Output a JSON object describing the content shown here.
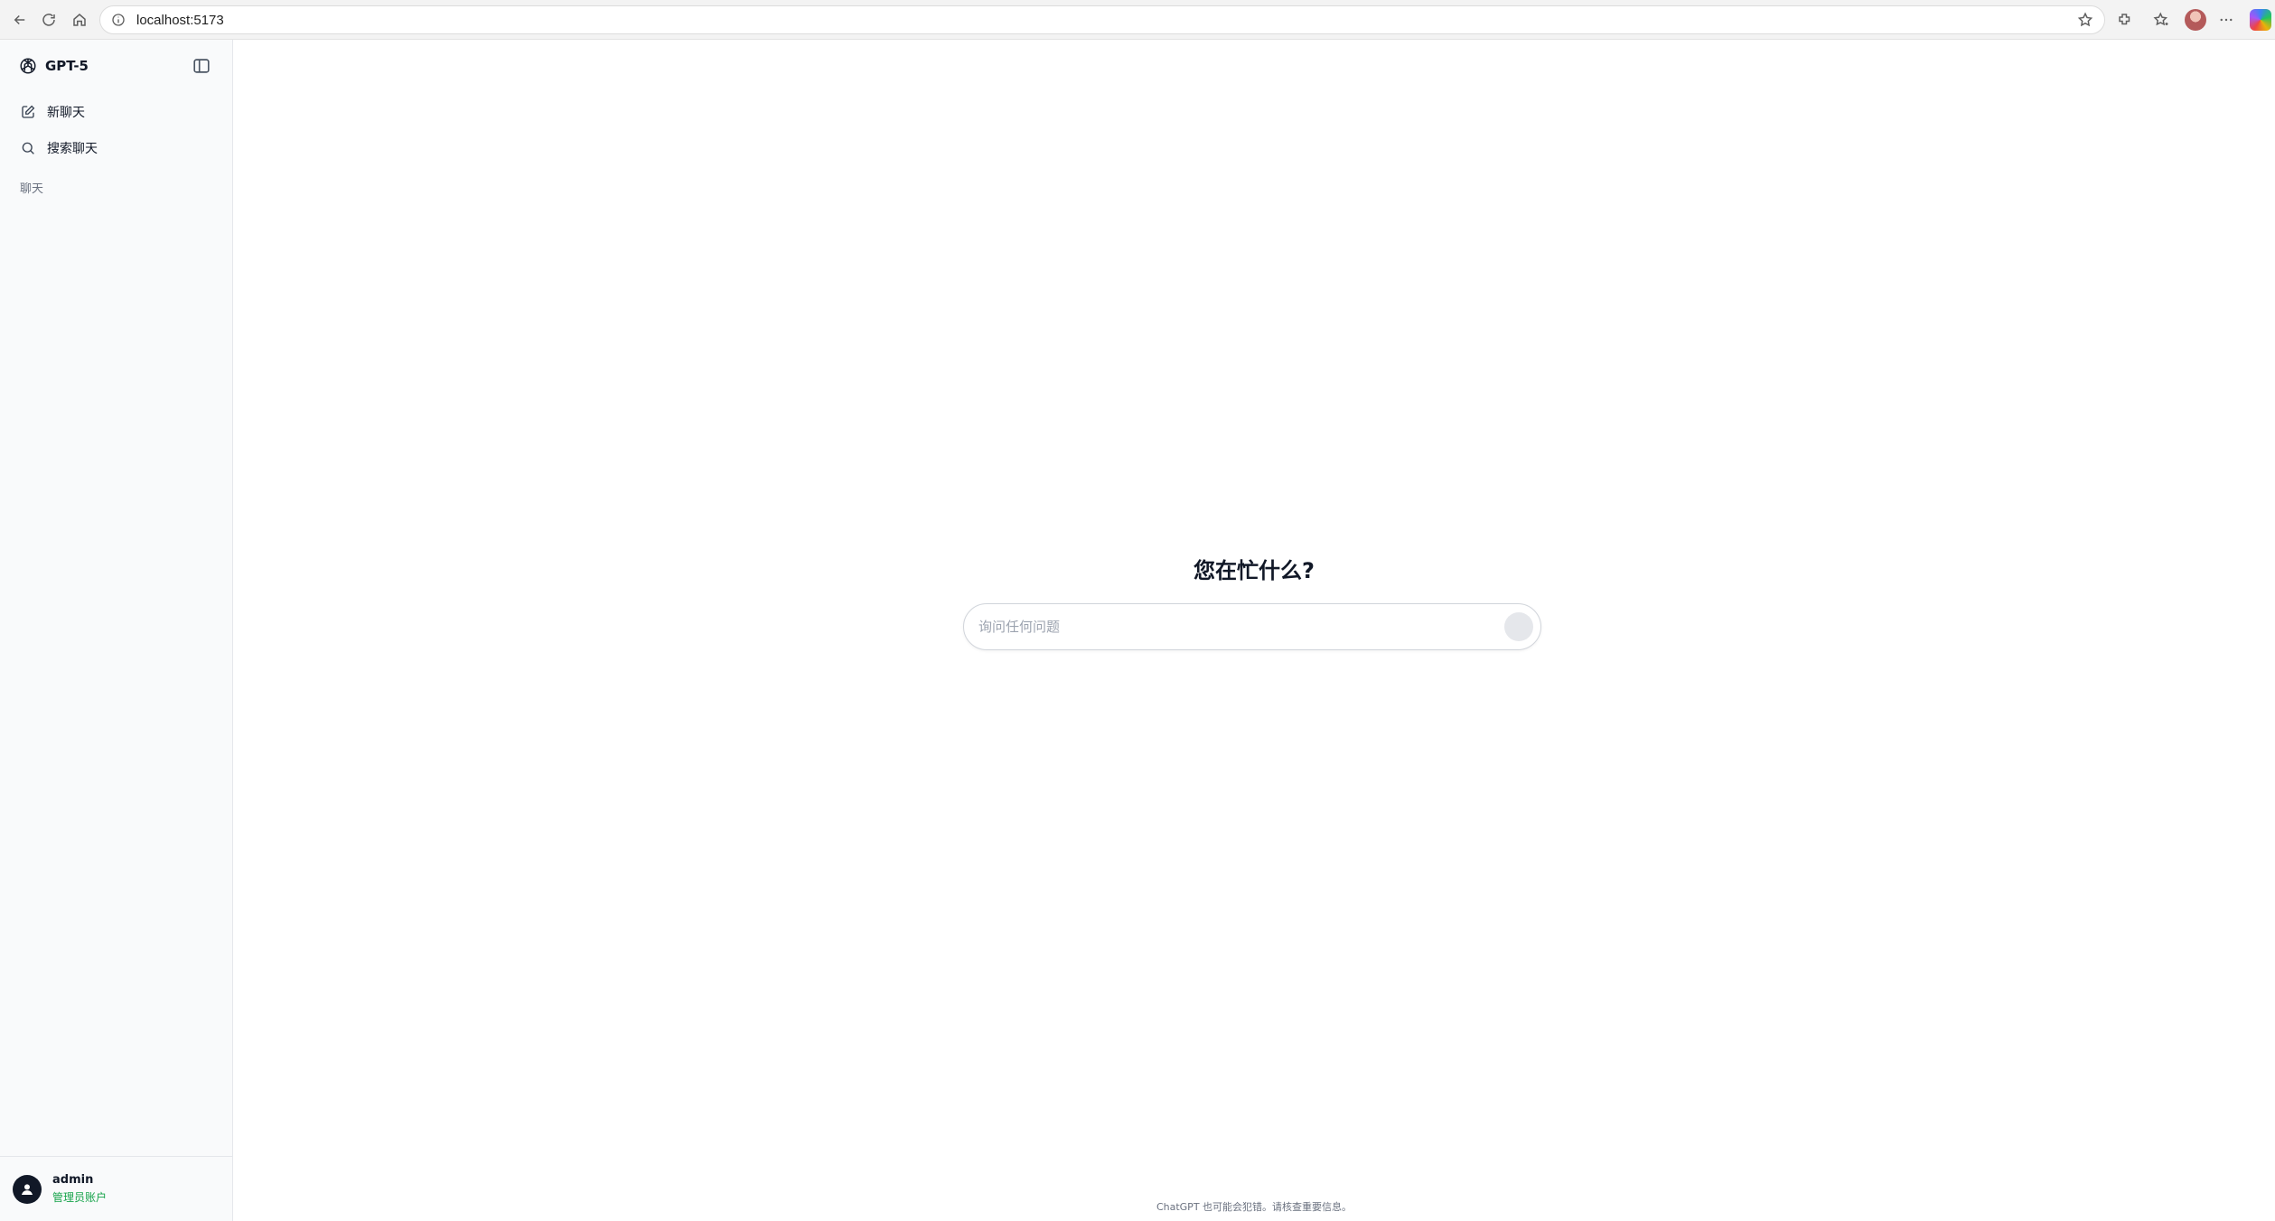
{
  "browser": {
    "url": "localhost:5173",
    "icons": [
      "back-arrow-icon",
      "reload-icon",
      "home-icon",
      "info-icon",
      "star-icon",
      "extensions-icon",
      "favorites-icon",
      "profile-avatar",
      "more-icon",
      "copilot-icon"
    ]
  },
  "sidebar": {
    "brand": "GPT-5",
    "items": [
      {
        "label": "新聊天",
        "icon": "edit-icon"
      },
      {
        "label": "搜索聊天",
        "icon": "search-icon"
      }
    ],
    "section_label": "聊天",
    "user": {
      "name": "admin",
      "role": "管理员账户",
      "role_color": "#16a34a"
    }
  },
  "main": {
    "greeting": "您在忙什么?",
    "composer": {
      "placeholder": "询问任何问题",
      "value": ""
    },
    "footer_note": "ChatGPT 也可能会犯错。请核查重要信息。"
  },
  "colors": {
    "sidebar_bg": "#f9fafb",
    "border": "#e5e7eb",
    "text": "#111827",
    "muted": "#6b7280",
    "send_button": "#e5e7eb"
  }
}
